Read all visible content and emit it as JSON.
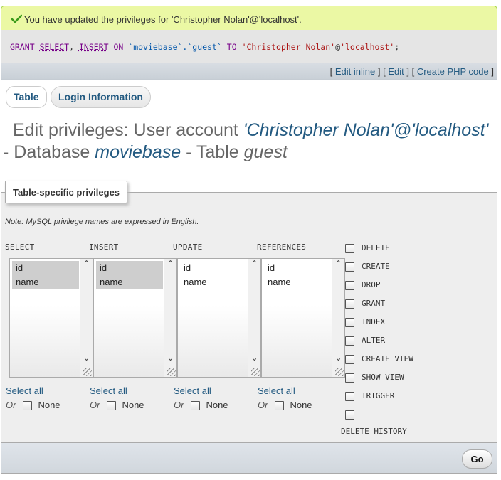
{
  "message": {
    "text": "You have updated the privileges for 'Christopher Nolan'@'localhost'.",
    "icon": "check-icon",
    "accent": "#a2d246"
  },
  "sql": {
    "grant": "GRANT",
    "select": "SELECT",
    "comma": ",",
    "insert": "INSERT",
    "on": "ON",
    "target": "`moviebase`.`guest`",
    "to": "TO",
    "user": "'Christopher Nolan'",
    "at": "@",
    "host": "'localhost'",
    "semicolon": ";"
  },
  "sql_menu": {
    "open1": "[",
    "edit_inline": "Edit inline",
    "sep1": "] [",
    "edit": "Edit",
    "sep2": "] [",
    "create_php": "Create PHP code",
    "close": "]"
  },
  "tabs": [
    {
      "label": "Table",
      "active": true
    },
    {
      "label": "Login Information",
      "active": false
    }
  ],
  "heading": {
    "prefix": "Edit privileges: User account",
    "account": "'Christopher Nolan'@'localhost'",
    "db_label": "- Database",
    "db_name": "moviebase",
    "table_label": "- Table",
    "table_name": "guest"
  },
  "fieldset": {
    "legend": "Table-specific privileges",
    "note": "Note: MySQL privilege names are expressed in English."
  },
  "columns": [
    {
      "header": "SELECT",
      "options": [
        "id",
        "name"
      ],
      "selected": [
        true,
        true
      ]
    },
    {
      "header": "INSERT",
      "options": [
        "id",
        "name"
      ],
      "selected": [
        true,
        true
      ]
    },
    {
      "header": "UPDATE",
      "options": [
        "id",
        "name"
      ],
      "selected": [
        false,
        false
      ]
    },
    {
      "header": "REFERENCES",
      "options": [
        "id",
        "name"
      ],
      "selected": [
        false,
        false
      ]
    }
  ],
  "select_all": "Select all",
  "or": "Or",
  "none": "None",
  "privileges": [
    "DELETE",
    "CREATE",
    "DROP",
    "GRANT",
    "INDEX",
    "ALTER",
    "CREATE VIEW",
    "SHOW VIEW",
    "TRIGGER",
    "DELETE HISTORY"
  ],
  "go_button": "Go"
}
